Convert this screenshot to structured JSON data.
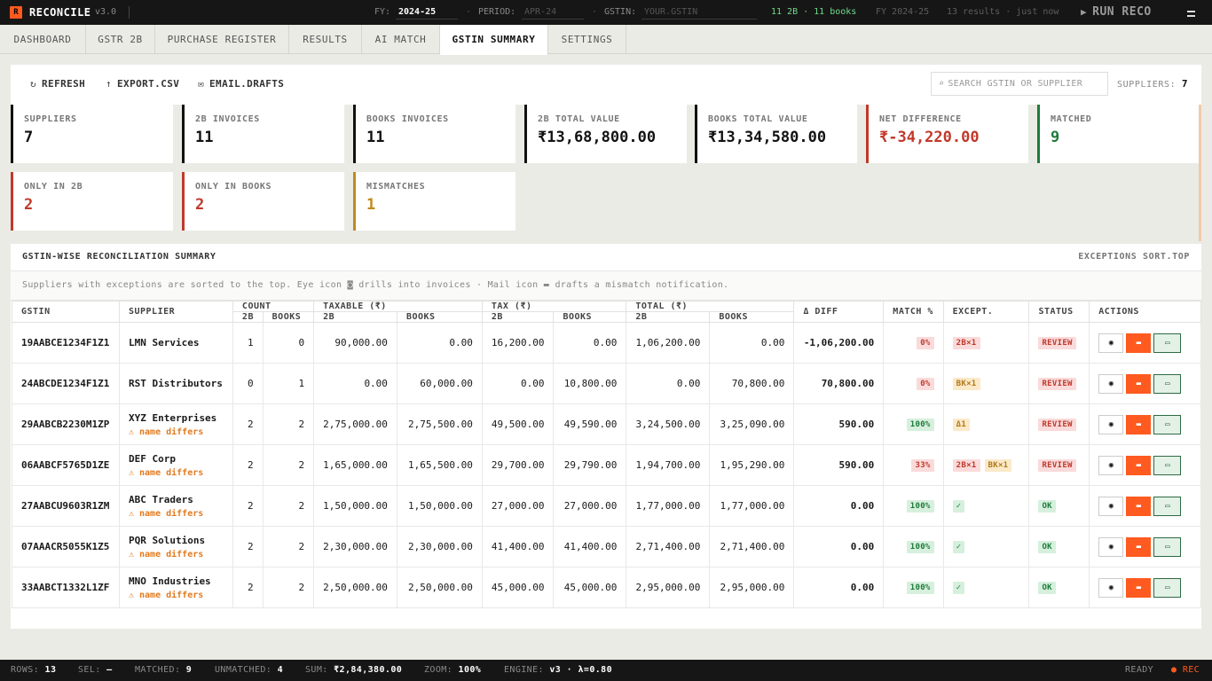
{
  "app": {
    "logo": "R",
    "name": "RECONCILE",
    "version": "v3.0"
  },
  "topbar": {
    "fy_label": "FY:",
    "fy_value": "2024-25",
    "period_label": "PERIOD:",
    "period_placeholder": "APR-24",
    "gstin_label": "GSTIN:",
    "gstin_placeholder": "YOUR.GSTIN",
    "counts": "11 2B · 11 books",
    "fy_info": "FY 2024-25",
    "results_info": "13 results · just now",
    "run_label": "RUN RECO",
    "run_icon": "play-icon",
    "menu_icon": "hamburger-icon"
  },
  "tabs": [
    "DASHBOARD",
    "GSTR 2B",
    "PURCHASE REGISTER",
    "RESULTS",
    "AI MATCH",
    "GSTIN SUMMARY",
    "SETTINGS"
  ],
  "active_tab": "GSTIN SUMMARY",
  "toolbar": {
    "refresh": "REFRESH",
    "refresh_icon": "↻",
    "export": "EXPORT.CSV",
    "export_icon": "↑",
    "email": "EMAIL.DRAFTS",
    "email_icon": "✉",
    "search_placeholder": "SEARCH GSTIN OR SUPPLIER",
    "search_icon": "⌕",
    "suppliers_label": "SUPPLIERS:",
    "suppliers_count": "7"
  },
  "stats": [
    {
      "label": "SUPPLIERS",
      "value": "7",
      "color": "#111111"
    },
    {
      "label": "2B INVOICES",
      "value": "11",
      "color": "#111111"
    },
    {
      "label": "BOOKS INVOICES",
      "value": "11",
      "color": "#111111"
    },
    {
      "label": "2B TOTAL VALUE",
      "value": "₹13,68,800.00",
      "color": "#111111"
    },
    {
      "label": "BOOKS TOTAL VALUE",
      "value": "₹13,34,580.00",
      "color": "#111111"
    },
    {
      "label": "NET DIFFERENCE",
      "value": "₹-34,220.00",
      "color": "#c0392b"
    },
    {
      "label": "MATCHED",
      "value": "9",
      "color": "#1e7a3a"
    },
    {
      "label": "ONLY IN 2B",
      "value": "2",
      "color": "#c0392b"
    },
    {
      "label": "ONLY IN BOOKS",
      "value": "2",
      "color": "#c0392b"
    },
    {
      "label": "MISMATCHES",
      "value": "1",
      "color": "#c08a1a"
    }
  ],
  "summary": {
    "title": "GSTIN-WISE RECONCILIATION SUMMARY",
    "sort_label": "EXCEPTIONS SORT.TOP",
    "note": "Suppliers with exceptions are sorted to the top. Eye icon ◙ drills into invoices · Mail icon ▬ drafts a mismatch notification."
  },
  "table": {
    "headers": {
      "gstin": "GSTIN",
      "supplier": "SUPPLIER",
      "count": "COUNT",
      "taxable": "TAXABLE (₹)",
      "tax": "TAX (₹)",
      "total": "TOTAL (₹)",
      "diff": "Δ DIFF",
      "match": "MATCH %",
      "except": "EXCEPT.",
      "status": "STATUS",
      "actions": "ACTIONS",
      "sub_2b": "2B",
      "sub_books": "BOOKS"
    },
    "rows": [
      {
        "gstin": "19AABCE1234F1Z1",
        "supplier": "LMN Services",
        "warn": "",
        "c2b": "1",
        "cbk": "0",
        "tx2b": "90,000.00",
        "txbk": "0.00",
        "t2b": "16,200.00",
        "tbk": "0.00",
        "tot2b": "1,06,200.00",
        "totbk": "0.00",
        "diff": "-1,06,200.00",
        "match": "0%",
        "match_kind": "red",
        "except": [
          {
            "t": "2B×1",
            "k": "red"
          }
        ],
        "status": "REVIEW",
        "status_kind": "red"
      },
      {
        "gstin": "24ABCDE1234F1Z1",
        "supplier": "RST Distributors",
        "warn": "",
        "c2b": "0",
        "cbk": "1",
        "tx2b": "0.00",
        "txbk": "60,000.00",
        "t2b": "0.00",
        "tbk": "10,800.00",
        "tot2b": "0.00",
        "totbk": "70,800.00",
        "diff": "70,800.00",
        "match": "0%",
        "match_kind": "red",
        "except": [
          {
            "t": "BK×1",
            "k": "amber"
          }
        ],
        "status": "REVIEW",
        "status_kind": "red"
      },
      {
        "gstin": "29AABCB2230M1ZP",
        "supplier": "XYZ Enterprises",
        "warn": "⚠ name differs",
        "c2b": "2",
        "cbk": "2",
        "tx2b": "2,75,000.00",
        "txbk": "2,75,500.00",
        "t2b": "49,500.00",
        "tbk": "49,590.00",
        "tot2b": "3,24,500.00",
        "totbk": "3,25,090.00",
        "diff": "590.00",
        "match": "100%",
        "match_kind": "green",
        "except": [
          {
            "t": "Δ1",
            "k": "amber"
          }
        ],
        "status": "REVIEW",
        "status_kind": "red"
      },
      {
        "gstin": "06AABCF5765D1ZE",
        "supplier": "DEF Corp",
        "warn": "⚠ name differs",
        "c2b": "2",
        "cbk": "2",
        "tx2b": "1,65,000.00",
        "txbk": "1,65,500.00",
        "t2b": "29,700.00",
        "tbk": "29,790.00",
        "tot2b": "1,94,700.00",
        "totbk": "1,95,290.00",
        "diff": "590.00",
        "match": "33%",
        "match_kind": "red",
        "except": [
          {
            "t": "2B×1",
            "k": "red"
          },
          {
            "t": "BK×1",
            "k": "amber"
          }
        ],
        "status": "REVIEW",
        "status_kind": "red"
      },
      {
        "gstin": "27AABCU9603R1ZM",
        "supplier": "ABC Traders",
        "warn": "⚠ name differs",
        "c2b": "2",
        "cbk": "2",
        "tx2b": "1,50,000.00",
        "txbk": "1,50,000.00",
        "t2b": "27,000.00",
        "tbk": "27,000.00",
        "tot2b": "1,77,000.00",
        "totbk": "1,77,000.00",
        "diff": "0.00",
        "match": "100%",
        "match_kind": "green",
        "except": [
          {
            "t": "✓",
            "k": "green"
          }
        ],
        "status": "OK",
        "status_kind": "green"
      },
      {
        "gstin": "07AAACR5055K1Z5",
        "supplier": "PQR Solutions",
        "warn": "⚠ name differs",
        "c2b": "2",
        "cbk": "2",
        "tx2b": "2,30,000.00",
        "txbk": "2,30,000.00",
        "t2b": "41,400.00",
        "tbk": "41,400.00",
        "tot2b": "2,71,400.00",
        "totbk": "2,71,400.00",
        "diff": "0.00",
        "match": "100%",
        "match_kind": "green",
        "except": [
          {
            "t": "✓",
            "k": "green"
          }
        ],
        "status": "OK",
        "status_kind": "green"
      },
      {
        "gstin": "33AABCT1332L1ZF",
        "supplier": "MNO Industries",
        "warn": "⚠ name differs",
        "c2b": "2",
        "cbk": "2",
        "tx2b": "2,50,000.00",
        "txbk": "2,50,000.00",
        "t2b": "45,000.00",
        "tbk": "45,000.00",
        "tot2b": "2,95,000.00",
        "totbk": "2,95,000.00",
        "diff": "0.00",
        "match": "100%",
        "match_kind": "green",
        "except": [
          {
            "t": "✓",
            "k": "green"
          }
        ],
        "status": "OK",
        "status_kind": "green"
      }
    ],
    "action_icons": {
      "view": "eye-icon",
      "mail": "mail-icon",
      "message": "message-icon"
    }
  },
  "statusbar": {
    "rows_label": "ROWS:",
    "rows": "13",
    "sel_label": "SEL:",
    "sel": "—",
    "matched_label": "MATCHED:",
    "matched": "9",
    "unmatched_label": "UNMATCHED:",
    "unmatched": "4",
    "sum_label": "SUM:",
    "sum": "₹2,84,380.00",
    "zoom_label": "ZOOM:",
    "zoom": "100%",
    "engine_label": "ENGINE:",
    "engine": "v3 · λ=0.80",
    "ready": "READY",
    "rec": "● REC"
  },
  "colors": {
    "accent": "#ff5a1f",
    "red": "#c0392b",
    "green": "#1e7a3a",
    "amber": "#c08a1a",
    "topbar": "#161616"
  }
}
